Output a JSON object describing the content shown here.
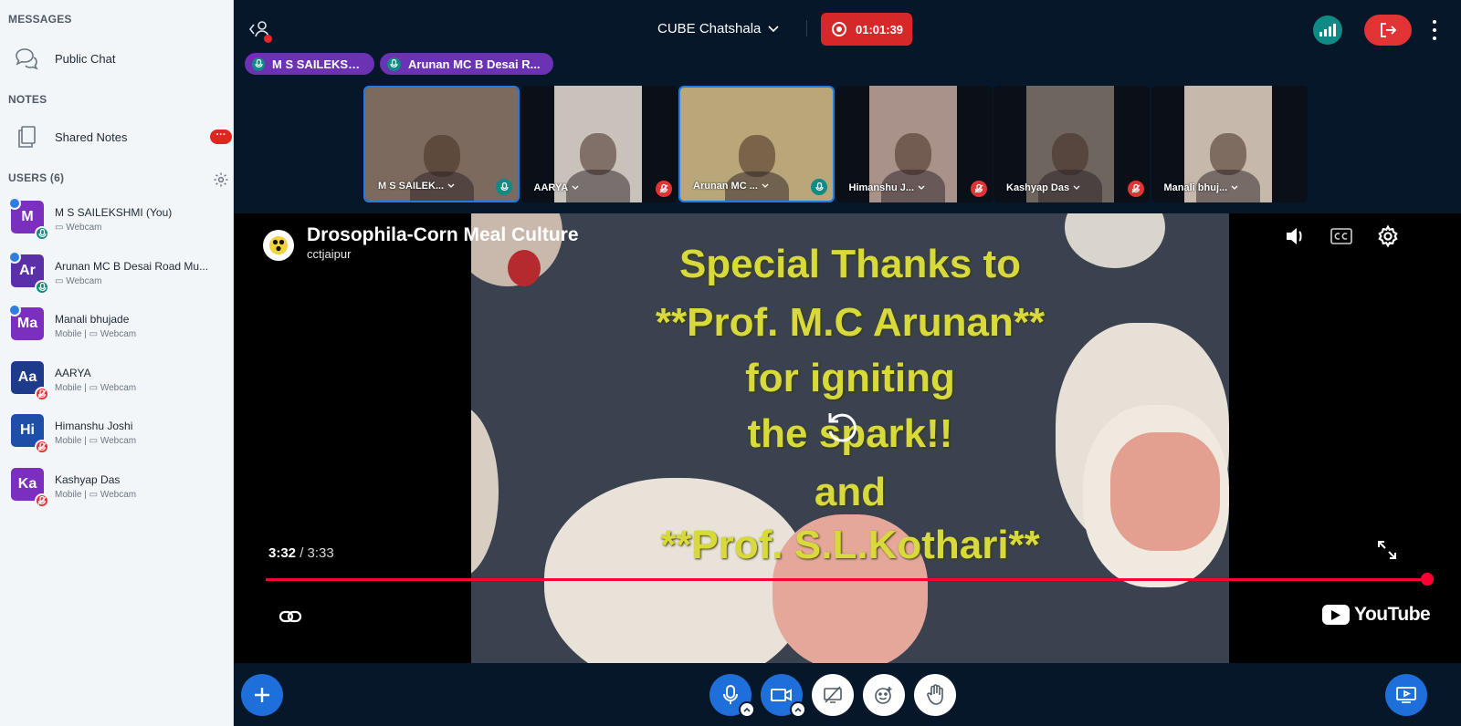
{
  "sidebar": {
    "messages_title": "MESSAGES",
    "public_chat": "Public Chat",
    "notes_title": "NOTES",
    "shared_notes": "Shared Notes",
    "shared_notes_badge": "···",
    "users_title": "USERS (6)",
    "users": [
      {
        "initials": "M",
        "name": "M S SAILEKSHMI (You)",
        "sub": "▭ Webcam",
        "color": "#7b2fbf",
        "status": "mic",
        "presenter": true
      },
      {
        "initials": "Ar",
        "name": "Arunan MC B Desai Road Mu...",
        "sub": "▭ Webcam",
        "color": "#5b2fa8",
        "status": "mic",
        "moderator": true
      },
      {
        "initials": "Ma",
        "name": "Manali bhujade",
        "sub": "Mobile | ▭ Webcam",
        "color": "#7b2fbf",
        "status": "none",
        "moderator": true
      },
      {
        "initials": "Aa",
        "name": "AARYA",
        "sub": "Mobile | ▭ Webcam",
        "color": "#1e3a8a",
        "status": "muted"
      },
      {
        "initials": "Hi",
        "name": "Himanshu Joshi",
        "sub": "Mobile | ▭ Webcam",
        "color": "#1e4fa8",
        "status": "muted"
      },
      {
        "initials": "Ka",
        "name": "Kashyap Das",
        "sub": "Mobile | ▭ Webcam",
        "color": "#7b2fbf",
        "status": "muted"
      }
    ]
  },
  "topbar": {
    "meeting_title": "CUBE Chatshala",
    "record_time": "01:01:39"
  },
  "talkers": [
    "M S SAILEKSHMI",
    "Arunan MC B Desai R..."
  ],
  "webcams": [
    {
      "name": "M S SAILEK...",
      "status": "mic",
      "active": true,
      "bg": "#7d6a5e"
    },
    {
      "name": "AARYA",
      "status": "muted",
      "active": false,
      "bg": "#c9c2bb"
    },
    {
      "name": "Arunan MC ...",
      "status": "mic",
      "active": true,
      "bg": "#b9a77a"
    },
    {
      "name": "Himanshu J...",
      "status": "muted",
      "active": false,
      "bg": "#a9928a"
    },
    {
      "name": "Kashyap Das",
      "status": "muted",
      "active": false,
      "bg": "#6e655e"
    },
    {
      "name": "Manali bhuj...",
      "status": "none",
      "active": false,
      "bg": "#c6b8aa"
    }
  ],
  "video": {
    "title": "Drosophila-Corn Meal Culture",
    "channel": "cctjaipur",
    "current_time": "3:32",
    "separator": " / ",
    "duration": "3:33",
    "progress": 0.995,
    "overlay_lines": [
      "Special Thanks to",
      "**Prof. M.C Arunan**",
      "for igniting",
      "the spark!!",
      "and",
      "**Prof. S.L.Kothari**"
    ],
    "brand": "YouTube"
  },
  "colors": {
    "accent": "#1e6fd9",
    "danger": "#e23434",
    "talker": "#6b33b4",
    "mic_on": "#0f8a84"
  }
}
